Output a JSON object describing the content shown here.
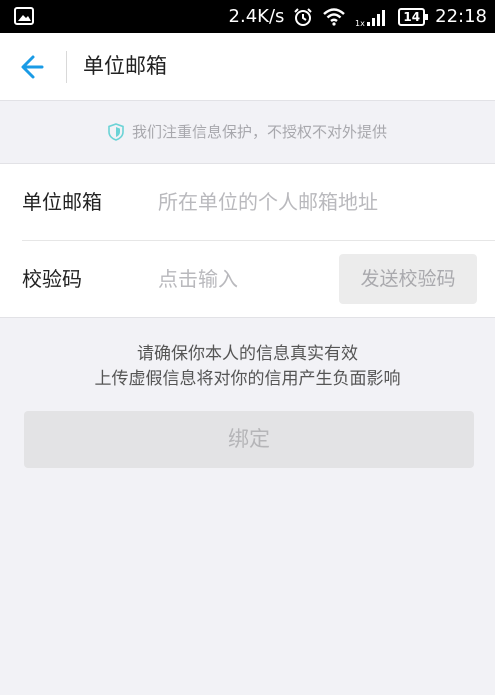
{
  "status_bar": {
    "speed": "2.4K/s",
    "battery": "14",
    "time": "22:18",
    "icons": [
      "image-icon",
      "alarm-icon",
      "wifi-icon",
      "signal-icon",
      "battery-icon"
    ]
  },
  "header": {
    "title": "单位邮箱",
    "back_icon": "arrow-left-icon",
    "accent_color": "#1a9be6"
  },
  "notice": {
    "icon": "shield-icon",
    "text": "我们注重信息保护，不授权不对外提供"
  },
  "form": {
    "email": {
      "label": "单位邮箱",
      "value": "",
      "placeholder": "所在单位的个人邮箱地址"
    },
    "code": {
      "label": "校验码",
      "value": "",
      "placeholder": "点击输入",
      "send_button": "发送校验码"
    }
  },
  "tips": {
    "line1": "请确保你本人的信息真实有效",
    "line2": "上传虚假信息将对你的信用产生负面影响"
  },
  "bind_button": "绑定"
}
